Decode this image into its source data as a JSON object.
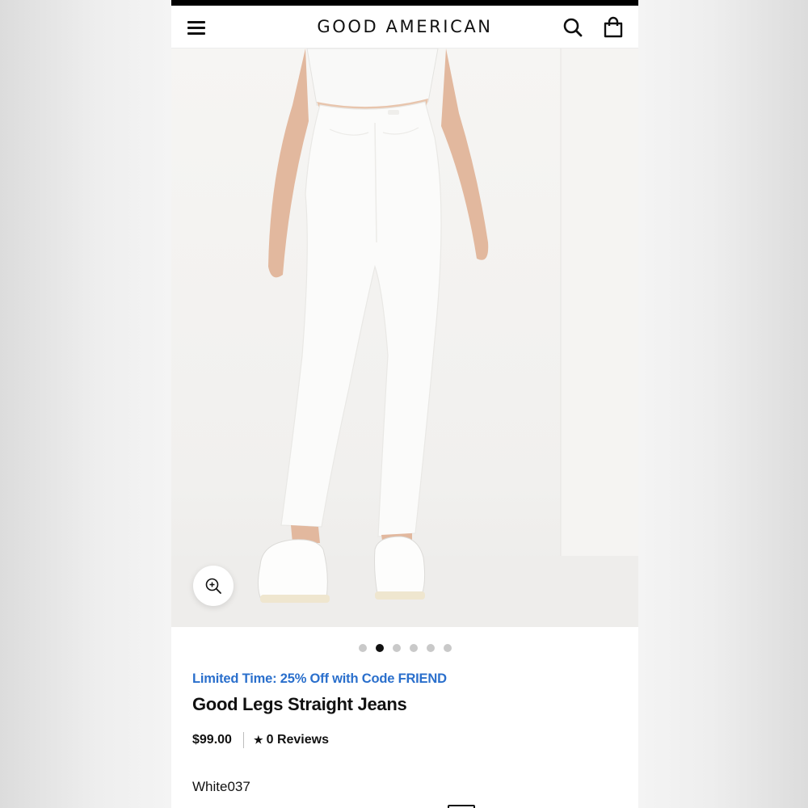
{
  "header": {
    "brand": "GOOD AMERICAN",
    "menu_icon": "hamburger-menu-icon",
    "search_icon": "search-icon",
    "cart_icon": "shopping-bag-icon"
  },
  "gallery": {
    "image_count": 6,
    "active_index": 1,
    "zoom_icon": "zoom-in-icon"
  },
  "product": {
    "promo": "Limited Time: 25% Off with Code FRIEND",
    "name": "Good Legs Straight Jeans",
    "price": "$99.00",
    "reviews": "0 Reviews",
    "star_icon": "★",
    "color": "White037"
  },
  "colors": {
    "promo": "#2a6fcc",
    "text": "#111111",
    "dot_active": "#111111",
    "dot_inactive": "#c9c9c9"
  }
}
